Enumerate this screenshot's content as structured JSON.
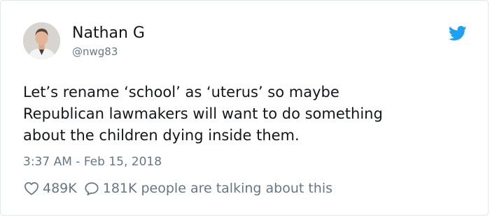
{
  "tweet": {
    "author": {
      "display_name": "Nathan G",
      "handle": "@nwg83"
    },
    "text_lines": [
      "Let’s rename ‘school’ as ‘uterus’ so maybe",
      "Republican lawmakers will want to do something",
      "about the children dying inside them."
    ],
    "timestamp": "3:37 AM - Feb 15, 2018",
    "stats": {
      "likes": "489K",
      "replies_text": "181K people are talking about this"
    }
  },
  "icons": {
    "brand": "twitter-bird-icon",
    "like": "heart-outline-icon",
    "reply": "speech-bubble-icon"
  },
  "colors": {
    "brand": "#1da1f2",
    "text": "#14171a",
    "secondary": "#657786",
    "border": "#e1e8ed"
  }
}
